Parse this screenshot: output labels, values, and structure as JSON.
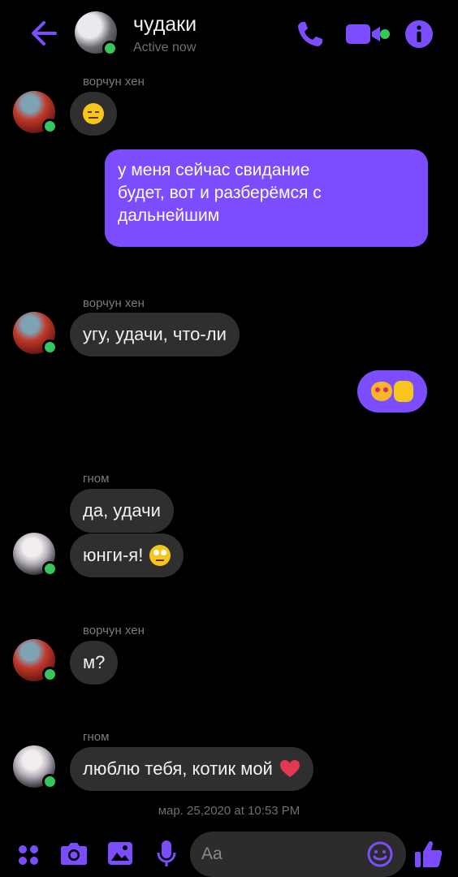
{
  "header": {
    "title": "чудаки",
    "status": "Active now"
  },
  "messages": {
    "m1_sender": "ворчун хен",
    "m2_text_line1": "у меня сейчас свидание",
    "m2_text_line2": "будет, вот и разберёмся с",
    "m2_text_line3": "дальнейшим",
    "m3_sender": "ворчун хен",
    "m3_text": "угу, удачи, что-ли",
    "m5_sender": "гном",
    "m5_text": "да, удачи",
    "m6_text": "юнги-я!",
    "m7_sender": "ворчун хен",
    "m7_text": "м?",
    "m8_sender": "гном",
    "m8_text": "люблю тебя, котик мой",
    "timestamp": "мар. 25,2020 at 10:53 PM"
  },
  "composer": {
    "placeholder": "Aa"
  },
  "colors": {
    "accent": "#7b4dff",
    "bubble_in": "#2f2f2f",
    "online": "#35c759"
  },
  "icons": [
    "back-arrow-icon",
    "phone-icon",
    "video-icon",
    "info-icon",
    "apps-icon",
    "camera-icon",
    "image-icon",
    "mic-icon",
    "emoji-icon",
    "like-icon"
  ]
}
